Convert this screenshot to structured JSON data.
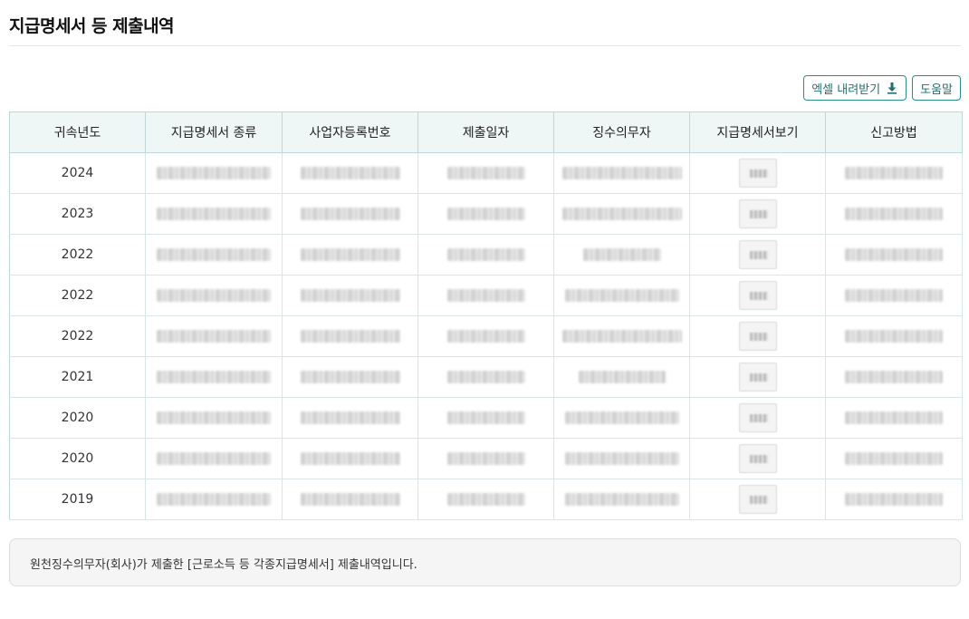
{
  "page": {
    "title": "지급명세서 등 제출내역"
  },
  "toolbar": {
    "excel_label": "엑셀 내려받기",
    "help_label": "도움말"
  },
  "table": {
    "headers": [
      "귀속년도",
      "지급명세서 종류",
      "사업자등록번호",
      "제출일자",
      "징수의무자",
      "지급명세서보기",
      "신고방법"
    ],
    "rows": [
      {
        "year": "2024"
      },
      {
        "year": "2023"
      },
      {
        "year": "2022"
      },
      {
        "year": "2022"
      },
      {
        "year": "2022"
      },
      {
        "year": "2021"
      },
      {
        "year": "2020"
      },
      {
        "year": "2020"
      },
      {
        "year": "2019"
      }
    ]
  },
  "note": {
    "text": "원천징수의무자(회사)가 제출한 [근로소득 등 각종지급명세서] 제출내역입니다."
  },
  "icons": {
    "excel_button_icon": "download-icon"
  },
  "colors": {
    "accent": "#2a8c8c",
    "header_bg": "#eef6f6",
    "note_bg": "#f5f5f5"
  }
}
